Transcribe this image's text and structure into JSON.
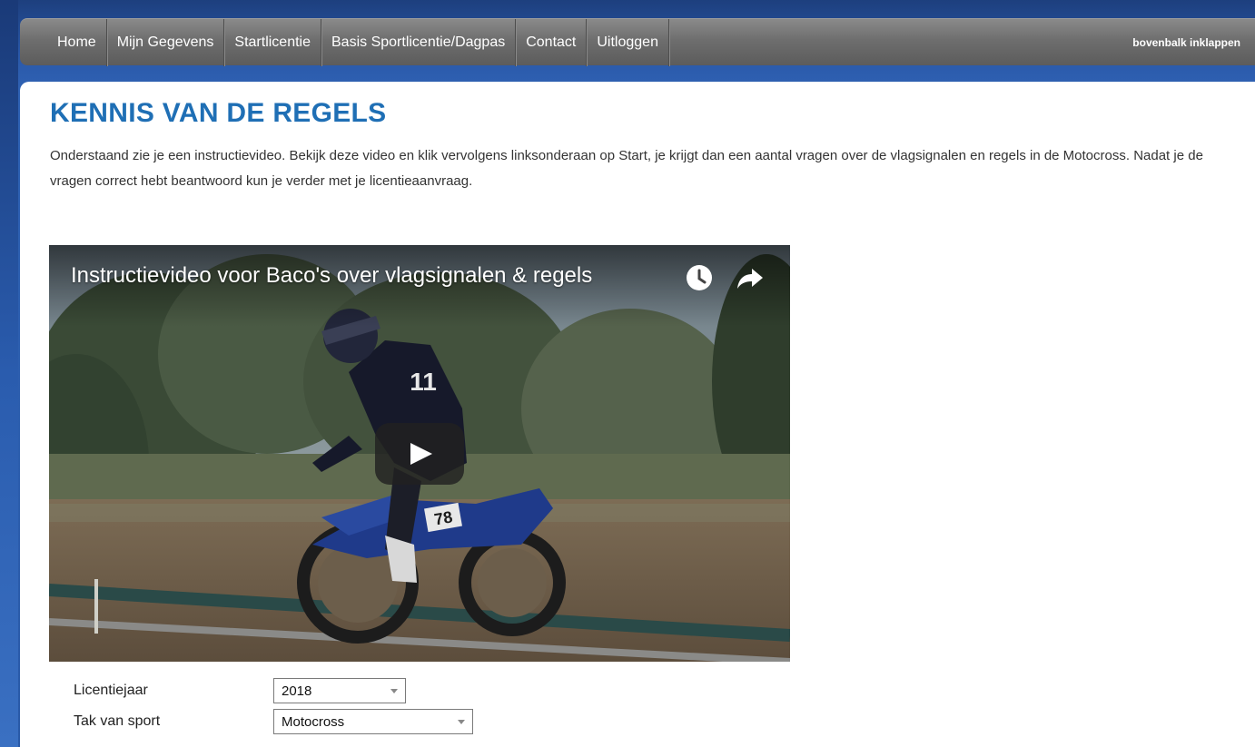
{
  "nav": {
    "items": [
      {
        "label": "Home"
      },
      {
        "label": "Mijn Gegevens"
      },
      {
        "label": "Startlicentie"
      },
      {
        "label": "Basis Sportlicentie/Dagpas"
      },
      {
        "label": "Contact"
      },
      {
        "label": "Uitloggen"
      }
    ],
    "collapse_label": "bovenbalk inklappen"
  },
  "page": {
    "title": "KENNIS VAN DE REGELS",
    "intro": "Onderstaand zie je een instructievideo. Bekijk deze video en klik vervolgens linksonderaan op Start, je krijgt dan een aantal vragen over de vlagsignalen en regels in de Motocross. Nadat je de vragen correct hebt beantwoord kun je verder met je licentieaanvraag."
  },
  "video": {
    "title": "Instructievideo voor Baco's over vlagsignalen & regels",
    "icons": [
      "watch-later-icon",
      "share-icon",
      "play-icon"
    ],
    "rider_number": "78",
    "jersey_number": "11"
  },
  "form": {
    "licentiejaar": {
      "label": "Licentiejaar",
      "value": "2018"
    },
    "tak_van_sport": {
      "label": "Tak van sport",
      "value": "Motocross"
    }
  },
  "colors": {
    "title": "#1f6fb5",
    "navbar": "#6e6e6e",
    "background": "#2a58a8"
  }
}
